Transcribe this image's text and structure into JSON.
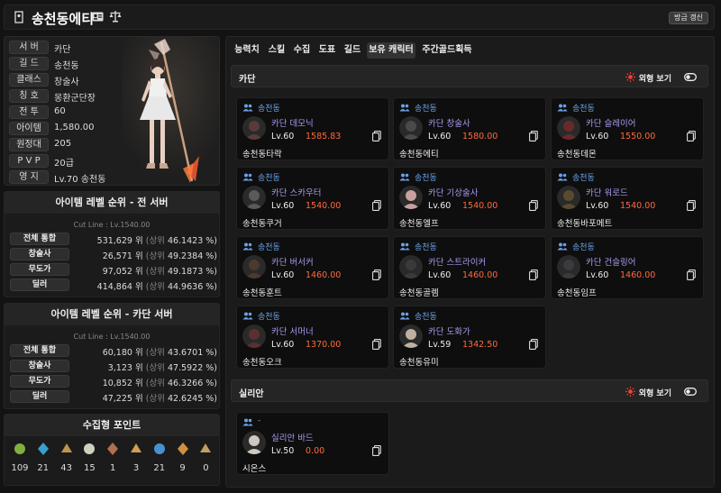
{
  "header": {
    "title": "송천동에티",
    "refresh_label": "방금 갱신"
  },
  "profile": {
    "rows": [
      {
        "label": "서 버",
        "value": "카단"
      },
      {
        "label": "길 드",
        "value": "송천동"
      },
      {
        "label": "클래스",
        "value": "창술사"
      },
      {
        "label": "칭 호",
        "value": "몽환군단장"
      },
      {
        "label": "전 투",
        "value": "60"
      },
      {
        "label": "아이템",
        "value": "1,580.00"
      },
      {
        "label": "원정대",
        "value": "205"
      },
      {
        "label": "P V P",
        "value": "20급"
      },
      {
        "label": "영 지",
        "value": "Lv.70 송천동"
      }
    ]
  },
  "rank_all": {
    "title": "아이템 레벨 순위 - 전 서버",
    "cutline": "Cut Line : Lv.1540.00",
    "rows": [
      {
        "label": "전체 통합",
        "rank": "531,629 위",
        "upper": "(상위",
        "pct": "46.1423 %)"
      },
      {
        "label": "창술사",
        "rank": "26,571 위",
        "upper": "(상위",
        "pct": "49.2384 %)"
      },
      {
        "label": "무도가",
        "rank": "97,052 위",
        "upper": "(상위",
        "pct": "49.1873 %)"
      },
      {
        "label": "딜러",
        "rank": "414,864 위",
        "upper": "(상위",
        "pct": "44.9636 %)"
      }
    ]
  },
  "rank_server": {
    "title": "아이템 레벨 순위 - 카단 서버",
    "cutline": "Cut Line : Lv.1540.00",
    "rows": [
      {
        "label": "전체 통합",
        "rank": "60,180 위",
        "upper": "(상위",
        "pct": "43.6701 %)"
      },
      {
        "label": "창술사",
        "rank": "3,123 위",
        "upper": "(상위",
        "pct": "47.5922 %)"
      },
      {
        "label": "무도가",
        "rank": "10,852 위",
        "upper": "(상위",
        "pct": "46.3266 %)"
      },
      {
        "label": "딜러",
        "rank": "47,225 위",
        "upper": "(상위",
        "pct": "42.6245 %)"
      }
    ]
  },
  "collect": {
    "title": "수집형 포인트",
    "items": [
      {
        "icon": "seed-icon",
        "count": "109",
        "color": "#7fb040"
      },
      {
        "icon": "island-heart-icon",
        "count": "21",
        "color": "#3aa0c8"
      },
      {
        "icon": "art-icon",
        "count": "43",
        "color": "#c0954a"
      },
      {
        "icon": "mokoko-icon",
        "count": "15",
        "color": "#d0d0c0"
      },
      {
        "icon": "giant-heart-icon",
        "count": "1",
        "color": "#b07050"
      },
      {
        "icon": "voyage-icon",
        "count": "3",
        "color": "#d0a050"
      },
      {
        "icon": "leaf-icon",
        "count": "21",
        "color": "#4a90d0"
      },
      {
        "icon": "star-icon",
        "count": "9",
        "color": "#d09040"
      },
      {
        "icon": "orb-icon",
        "count": "0",
        "color": "#c0a060"
      }
    ]
  },
  "tabs": [
    "능력치",
    "스킬",
    "수집",
    "도표",
    "길드",
    "보유 캐릭터",
    "주간골드획득"
  ],
  "sections": [
    {
      "title": "카단",
      "view_label": "외형 보기",
      "cards": [
        {
          "guild": "송천동",
          "server": "카단",
          "class": "데모닉",
          "level": "Lv.60",
          "ilvl": "1585.83",
          "name": "송천동타락"
        },
        {
          "guild": "송천동",
          "server": "카단",
          "class": "창술사",
          "level": "Lv.60",
          "ilvl": "1580.00",
          "name": "송천동에티"
        },
        {
          "guild": "송천동",
          "server": "카단",
          "class": "슬레이어",
          "level": "Lv.60",
          "ilvl": "1550.00",
          "name": "송천동데몬"
        },
        {
          "guild": "송천동",
          "server": "카단",
          "class": "스카우터",
          "level": "Lv.60",
          "ilvl": "1540.00",
          "name": "송천동쿠거"
        },
        {
          "guild": "송천동",
          "server": "카단",
          "class": "기상술사",
          "level": "Lv.60",
          "ilvl": "1540.00",
          "name": "송천동엘프"
        },
        {
          "guild": "송천동",
          "server": "카단",
          "class": "워로드",
          "level": "Lv.60",
          "ilvl": "1540.00",
          "name": "송천동바포메트"
        },
        {
          "guild": "송천동",
          "server": "카단",
          "class": "버서커",
          "level": "Lv.60",
          "ilvl": "1460.00",
          "name": "송천동훈트"
        },
        {
          "guild": "송천동",
          "server": "카단",
          "class": "스트라이커",
          "level": "Lv.60",
          "ilvl": "1460.00",
          "name": "송천동골렘"
        },
        {
          "guild": "송천동",
          "server": "카단",
          "class": "건슬링어",
          "level": "Lv.60",
          "ilvl": "1460.00",
          "name": "송천동임프"
        },
        {
          "guild": "송천동",
          "server": "카단",
          "class": "서머너",
          "level": "Lv.60",
          "ilvl": "1370.00",
          "name": "송천동오크"
        },
        {
          "guild": "송천동",
          "server": "카단",
          "class": "도화가",
          "level": "Lv.59",
          "ilvl": "1342.50",
          "name": "송천동유미"
        }
      ]
    },
    {
      "title": "실리안",
      "view_label": "외형 보기",
      "cards": [
        {
          "guild": "-",
          "server": "실리안",
          "class": "바드",
          "level": "Lv.50",
          "ilvl": "0.00",
          "name": "시온스"
        }
      ]
    }
  ],
  "colors": {
    "accent_blue": "#6aa0e8",
    "class_purple": "#a89bf0",
    "ilvl_orange": "#ff6a3c",
    "sun_red": "#ff3b30"
  }
}
